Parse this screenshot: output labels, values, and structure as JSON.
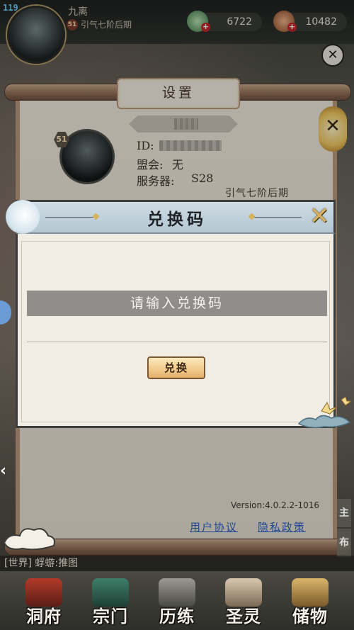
{
  "hud": {
    "fps": "119",
    "player_name": "九离",
    "level": "51",
    "rank": "引气七阶后期",
    "jade": "6722",
    "copper": "10482"
  },
  "settings": {
    "title": "设置",
    "level": "51",
    "id_label": "ID:",
    "guild_label": "盟会:",
    "guild_value": "无",
    "server_label": "服务器:",
    "server_value": "S28",
    "rank": "引气七阶后期",
    "version": "Version:4.0.2.2-1016",
    "user_agreement": "用户协议",
    "privacy_policy": "隐私政策"
  },
  "redeem": {
    "title": "兑换码",
    "placeholder": "请输入兑换码",
    "value": "",
    "button": "兑换"
  },
  "chat": {
    "tag": "[世界]",
    "text": "蜉蝣:推图"
  },
  "nav": [
    {
      "label": "洞府"
    },
    {
      "label": "宗门"
    },
    {
      "label": "历练"
    },
    {
      "label": "圣灵"
    },
    {
      "label": "储物"
    }
  ],
  "side": {
    "right_a": "主",
    "right_b": "布"
  },
  "colors": {
    "accent_gold": "#d7b15f",
    "link_blue": "#2a5fc8",
    "dialog_header": "#b4c7d2",
    "button": "#f1c98a"
  },
  "icons": {
    "close_top": "close-icon",
    "dialog_close": "cross-icon"
  }
}
